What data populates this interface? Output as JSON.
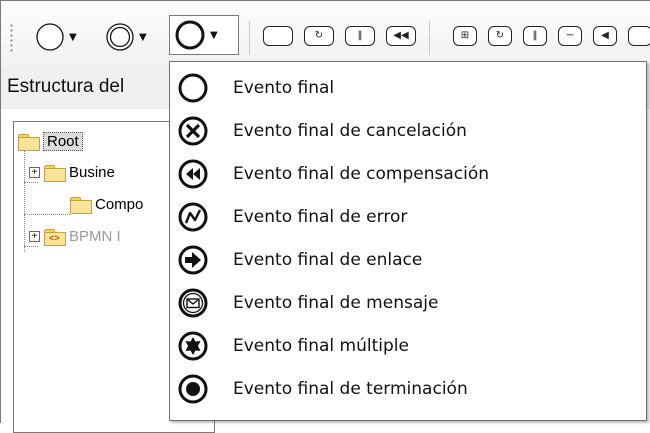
{
  "panel": {
    "title": "Estructura del"
  },
  "tree": {
    "items": [
      {
        "label": "Root"
      },
      {
        "label": "Busine"
      },
      {
        "label": "Compo"
      },
      {
        "label": "BPMN I"
      }
    ],
    "xml_badge": "<>"
  },
  "menu": {
    "items": [
      {
        "label": "Evento final",
        "icon": "end-event-icon"
      },
      {
        "label": "Evento final de cancelación",
        "icon": "cancel-end-event-icon"
      },
      {
        "label": "Evento final de compensación",
        "icon": "compensation-end-event-icon"
      },
      {
        "label": "Evento final de error",
        "icon": "error-end-event-icon"
      },
      {
        "label": "Evento final de enlace",
        "icon": "link-end-event-icon"
      },
      {
        "label": "Evento final de mensaje",
        "icon": "message-end-event-icon"
      },
      {
        "label": "Evento final múltiple",
        "icon": "multiple-end-event-icon"
      },
      {
        "label": "Evento final de terminación",
        "icon": "terminate-end-event-icon"
      }
    ]
  },
  "toolbar": {
    "buttons": [
      {
        "icon": "start-event-icon"
      },
      {
        "icon": "intermediate-event-icon"
      },
      {
        "icon": "end-event-icon"
      },
      {
        "icon": "task-icon"
      },
      {
        "icon": "loop-task-icon"
      },
      {
        "icon": "parallel-task-icon"
      },
      {
        "icon": "compensation-task-icon"
      },
      {
        "icon": "subprocess-icon"
      },
      {
        "icon": "loop-subprocess-icon"
      },
      {
        "icon": "parallel-subprocess-icon"
      },
      {
        "icon": "adhoc-subprocess-icon"
      },
      {
        "icon": "compensation-subprocess-icon"
      }
    ]
  }
}
